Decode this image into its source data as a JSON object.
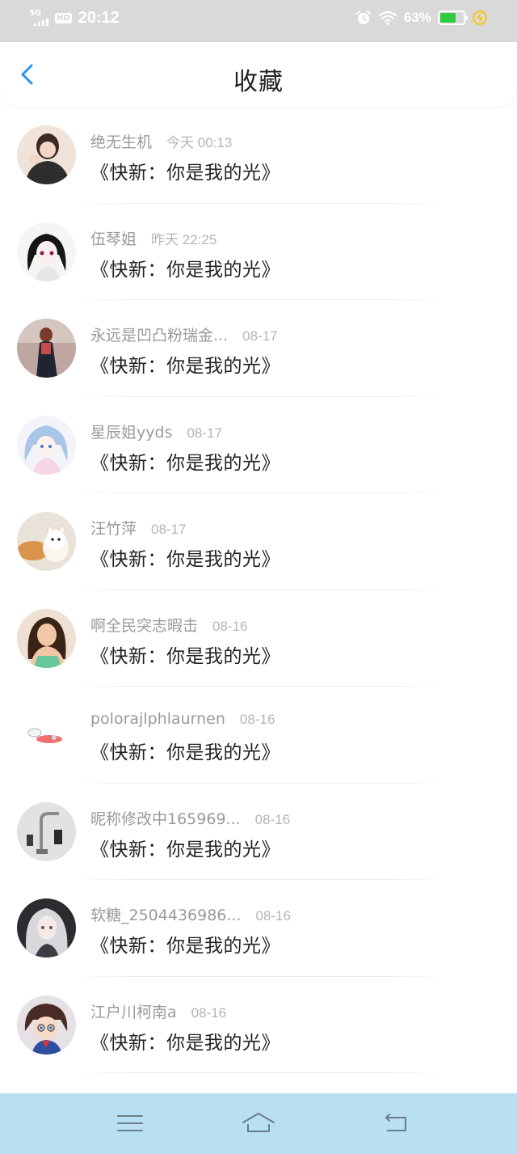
{
  "status_bar": {
    "network": "5G",
    "hd": "HD",
    "time": "20:12",
    "battery_percent": "63%",
    "battery_level": 0.63,
    "icons": [
      "signal-icon",
      "alarm-icon",
      "wifi-icon",
      "battery-icon",
      "charging-icon"
    ]
  },
  "header": {
    "title": "收藏",
    "back_icon": "chevron-left-icon"
  },
  "items": [
    {
      "name": "绝无生机",
      "time": "今天 00:13",
      "title": "《快新：你是我的光》"
    },
    {
      "name": "伍琴姐",
      "time": "昨天 22:25",
      "title": "《快新：你是我的光》"
    },
    {
      "name": "永远是凹凸粉瑞金...",
      "time": "08-17",
      "title": "《快新：你是我的光》"
    },
    {
      "name": "星辰姐yyds",
      "time": "08-17",
      "title": "《快新：你是我的光》"
    },
    {
      "name": "汪竹萍",
      "time": "08-17",
      "title": "《快新：你是我的光》"
    },
    {
      "name": "啊全民突志暇击",
      "time": "08-16",
      "title": "《快新：你是我的光》"
    },
    {
      "name": "polorajlphlaurnen",
      "time": "08-16",
      "title": "《快新：你是我的光》"
    },
    {
      "name": "昵称修改中165969...",
      "time": "08-16",
      "title": "《快新：你是我的光》"
    },
    {
      "name": "软糖_2504436986...",
      "time": "08-16",
      "title": "《快新：你是我的光》"
    },
    {
      "name": "江户川柯南a",
      "time": "08-16",
      "title": "《快新：你是我的光》"
    }
  ],
  "bottom_nav": {
    "icons": [
      "menu-icon",
      "home-icon",
      "back-icon"
    ]
  },
  "colors": {
    "accent": "#2196f3",
    "status_bar": "#d9d9d9",
    "bottom_bar": "#b9dff2",
    "name_text": "#9a9a9a",
    "title_text": "#222222",
    "battery": "#2ecc40",
    "charging": "#f5c518"
  }
}
